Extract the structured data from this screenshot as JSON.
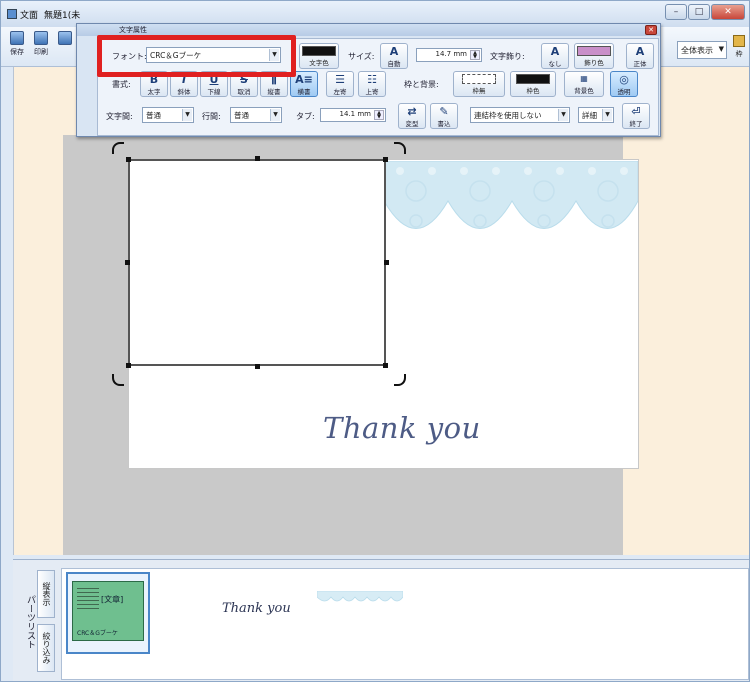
{
  "app": {
    "title_parts": [
      "文面",
      "無題1(未"
    ]
  },
  "toolbar": {
    "save": "保存",
    "print": "印刷",
    "zoom_value": "全体表示",
    "frame_button": "枠"
  },
  "text_props": {
    "window_title": "文字属性",
    "font_label": "フォント:",
    "font_value": "CRC＆Gブーケ",
    "text_color_label": "文字色",
    "size_label": "サイズ:",
    "size_auto_label": "自動",
    "size_value": "14.7 mm",
    "text_decoration_label": "文字飾り:",
    "deco_none_label": "なし",
    "border_color_label": "飾り色",
    "direction_label": "正体",
    "style_label": "書式:",
    "style_buttons": [
      "太字",
      "斜体",
      "下線",
      "取消",
      "縦書",
      "横書",
      "左寄",
      "上寄"
    ],
    "frame_bg_label": "枠と背景:",
    "frame_none_label": "枠無",
    "frame_color_label": "枠色",
    "bg_color_label": "背景色",
    "transparent_label": "透明",
    "char_spacing_label": "文字間:",
    "char_spacing_value": "普通",
    "line_spacing_label": "行間:",
    "line_spacing_value": "普通",
    "tab_label": "タブ:",
    "tab_value": "14.1 mm",
    "convert_label": "変型",
    "read_label": "書込",
    "link_value": "連結枠を使用しない",
    "detail_label": "詳細",
    "finish_label": "終了"
  },
  "canvas": {
    "card_text": "Thank you"
  },
  "parts": {
    "panel_label": "パーツリスト",
    "tab_display": "縦表示",
    "tab_filter": "絞り込み",
    "item_label": "[文章]",
    "item_sub": "CRC＆Gブーケ",
    "thank_text": "Thank you"
  }
}
